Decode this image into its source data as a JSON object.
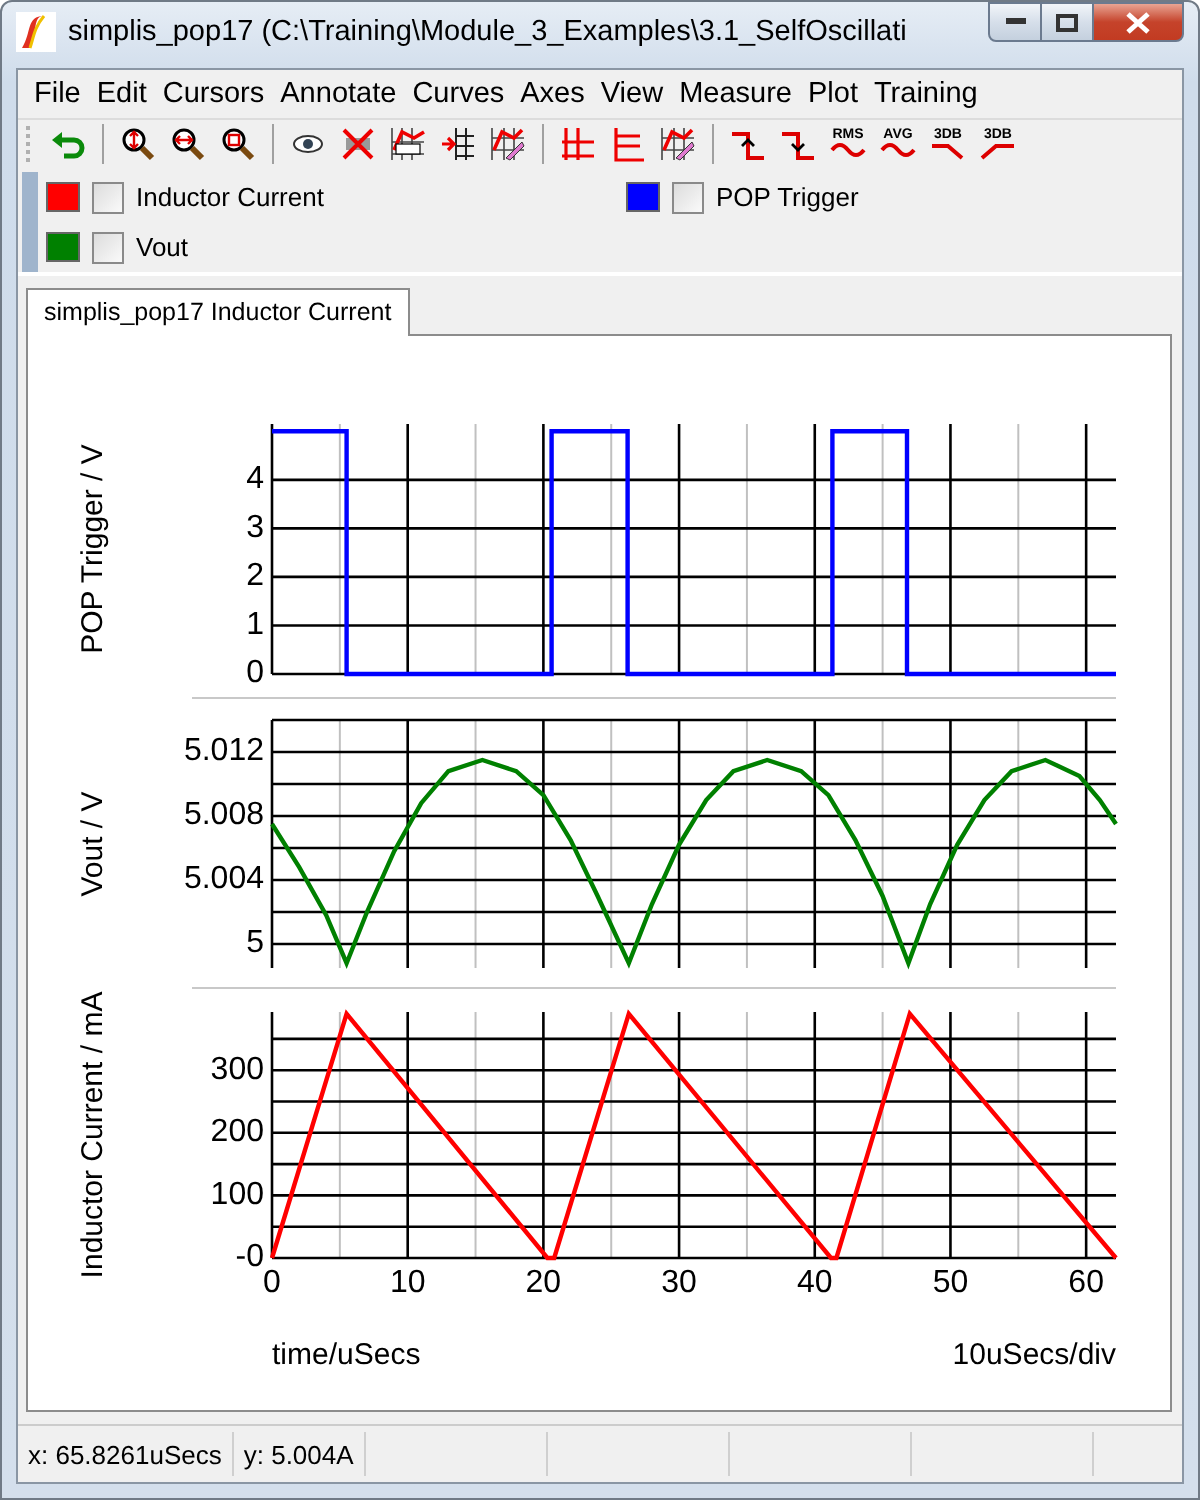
{
  "window": {
    "title": "simplis_pop17 (C:\\Training\\Module_3_Examples\\3.1_SelfOscillati"
  },
  "menu": [
    {
      "label": "File"
    },
    {
      "label": "Edit"
    },
    {
      "label": "Cursors"
    },
    {
      "label": "Annotate"
    },
    {
      "label": "Curves"
    },
    {
      "label": "Axes"
    },
    {
      "label": "View"
    },
    {
      "label": "Measure"
    },
    {
      "label": "Plot"
    },
    {
      "label": "Training"
    }
  ],
  "toolbar": [
    {
      "kind": "undo"
    },
    {
      "kind": "separator"
    },
    {
      "kind": "zoom-vertical"
    },
    {
      "kind": "zoom-horizontal"
    },
    {
      "kind": "zoom-box"
    },
    {
      "kind": "separator"
    },
    {
      "kind": "eye"
    },
    {
      "kind": "hide-curve"
    },
    {
      "kind": "label-curve"
    },
    {
      "kind": "add-axis"
    },
    {
      "kind": "edit-curve"
    },
    {
      "kind": "separator"
    },
    {
      "kind": "grid"
    },
    {
      "kind": "axis-lines"
    },
    {
      "kind": "edit-axis"
    },
    {
      "kind": "separator"
    },
    {
      "kind": "rise"
    },
    {
      "kind": "fall"
    },
    {
      "kind": "wave-text",
      "label": "RMS"
    },
    {
      "kind": "wave-text",
      "label": "AVG"
    },
    {
      "kind": "slope-down-text",
      "label": "3DB"
    },
    {
      "kind": "slope-up-text",
      "label": "3DB"
    }
  ],
  "legend": [
    {
      "label": "Inductor Current",
      "color": "#ff0000",
      "checked": false
    },
    {
      "label": "POP Trigger",
      "color": "#0000ff",
      "checked": false
    },
    {
      "label": "Vout",
      "color": "#008000",
      "checked": false
    }
  ],
  "tabs": [
    {
      "label": "simplis_pop17 Inductor Current",
      "selected": true
    }
  ],
  "plot": {
    "charts": [
      {
        "chart_data": {
          "type": "line",
          "ylabel": "POP Trigger / V",
          "xlim": [
            0,
            62.2
          ],
          "ylim": [
            0,
            5.15
          ],
          "grid": true,
          "yticks": [
            {
              "value": 0,
              "label": "0"
            },
            {
              "value": 1,
              "label": "1"
            },
            {
              "value": 2,
              "label": "2"
            },
            {
              "value": 3,
              "label": "3"
            },
            {
              "value": 4,
              "label": "4"
            }
          ],
          "x": [
            0,
            5.5,
            5.5,
            20.6,
            20.6,
            26.2,
            26.2,
            41.3,
            41.3,
            46.8,
            46.8,
            62.2
          ],
          "series": [
            {
              "color": "#0000ff",
              "values": [
                5,
                5,
                0,
                0,
                5,
                5,
                0,
                0,
                5,
                5,
                0,
                0
              ]
            }
          ]
        }
      },
      {
        "chart_data": {
          "type": "line",
          "ylabel": "Vout / V",
          "xlim": [
            0,
            62.2
          ],
          "ylim": [
            4.9985,
            5.014
          ],
          "grid": true,
          "yticks": [
            {
              "value": 5,
              "label": "5"
            },
            {
              "value": 5.004,
              "label": "5.004"
            },
            {
              "value": 5.008,
              "label": "5.008"
            },
            {
              "value": 5.012,
              "label": "5.012"
            }
          ],
          "x": [
            0,
            2,
            4,
            5.5,
            7,
            9,
            11,
            13,
            15.5,
            18,
            20,
            22,
            24,
            26.3,
            28,
            30,
            32,
            34,
            36.5,
            39,
            41,
            43,
            45,
            46.9,
            48.5,
            50.5,
            52.5,
            54.5,
            57,
            59.5,
            61,
            62.2
          ],
          "series": [
            {
              "color": "#008000",
              "values": [
                5.0075,
                5.0048,
                5.0018,
                4.9988,
                5.002,
                5.0058,
                5.0088,
                5.0108,
                5.0115,
                5.0108,
                5.0093,
                5.0065,
                5.003,
                4.9988,
                5.0025,
                5.0062,
                5.009,
                5.0108,
                5.0115,
                5.0108,
                5.0093,
                5.0065,
                5.003,
                4.9988,
                5.0025,
                5.0062,
                5.009,
                5.0108,
                5.0115,
                5.0105,
                5.009,
                5.0075
              ]
            }
          ]
        }
      },
      {
        "chart_data": {
          "type": "line",
          "ylabel": "Inductor Current / mA",
          "xlim": [
            0,
            62.2
          ],
          "ylim": [
            0,
            393
          ],
          "grid": true,
          "xticks": [
            {
              "value": 0,
              "label": "0"
            },
            {
              "value": 10,
              "label": "10"
            },
            {
              "value": 20,
              "label": "20"
            },
            {
              "value": 30,
              "label": "30"
            },
            {
              "value": 40,
              "label": "40"
            },
            {
              "value": 50,
              "label": "50"
            },
            {
              "value": 60,
              "label": "60"
            }
          ],
          "yticks": [
            {
              "value": 0,
              "label": "-0"
            },
            {
              "value": 100,
              "label": "100"
            },
            {
              "value": 200,
              "label": "200"
            },
            {
              "value": 300,
              "label": "300"
            }
          ],
          "x": [
            0,
            5.5,
            20.3,
            20.8,
            26.3,
            41.2,
            41.6,
            47,
            62.2
          ],
          "series": [
            {
              "color": "#ff0000",
              "values": [
                0,
                390,
                0,
                0,
                390,
                0,
                0,
                390,
                0
              ]
            }
          ]
        }
      }
    ],
    "xlabel": "time/uSecs",
    "scale": "10uSecs/div"
  },
  "status_bar": [
    "x: 65.8261uSecs",
    "y: 5.004A"
  ]
}
